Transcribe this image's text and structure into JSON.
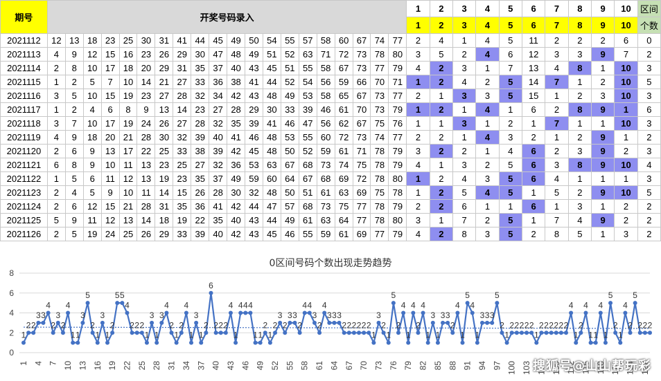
{
  "sheet": {
    "issue_header": "期号",
    "numbers_header": "开奖号码录入",
    "zone_header_top": [
      "1",
      "2",
      "3",
      "4",
      "5",
      "6",
      "7",
      "8",
      "9",
      "10"
    ],
    "zone_header_bottom": [
      "1",
      "2",
      "3",
      "4",
      "5",
      "6",
      "7",
      "8",
      "9",
      "10"
    ],
    "count_header_top": "区间",
    "count_header_bottom": "个数",
    "rows": [
      {
        "issue": "2021112",
        "nums": [
          "12",
          "13",
          "18",
          "23",
          "25",
          "30",
          "31",
          "41",
          "44",
          "45",
          "49",
          "50",
          "54",
          "55",
          "57",
          "58",
          "60",
          "67",
          "74",
          "77"
        ],
        "zones": [
          "2",
          "4",
          "1",
          "4",
          "5",
          "11",
          "2",
          "2",
          "2",
          "6"
        ],
        "count": "0",
        "hits": []
      },
      {
        "issue": "2021113",
        "nums": [
          "4",
          "9",
          "12",
          "15",
          "16",
          "23",
          "26",
          "29",
          "30",
          "47",
          "48",
          "49",
          "51",
          "52",
          "63",
          "71",
          "72",
          "73",
          "78",
          "80"
        ],
        "zones": [
          "3",
          "5",
          "2",
          "4",
          "6",
          "12",
          "3",
          "3",
          "9",
          "7"
        ],
        "count": "2",
        "hits": [
          3,
          8
        ]
      },
      {
        "issue": "2021114",
        "nums": [
          "2",
          "8",
          "10",
          "17",
          "18",
          "20",
          "29",
          "31",
          "35",
          "37",
          "40",
          "43",
          "45",
          "51",
          "55",
          "58",
          "67",
          "73",
          "77",
          "79"
        ],
        "zones": [
          "4",
          "2",
          "3",
          "1",
          "7",
          "13",
          "4",
          "8",
          "1",
          "10"
        ],
        "count": "3",
        "hits": [
          1,
          7,
          9
        ]
      },
      {
        "issue": "2021115",
        "nums": [
          "1",
          "2",
          "5",
          "7",
          "10",
          "14",
          "21",
          "27",
          "33",
          "36",
          "38",
          "41",
          "44",
          "52",
          "54",
          "56",
          "59",
          "66",
          "70",
          "71"
        ],
        "zones": [
          "1",
          "2",
          "4",
          "2",
          "5",
          "14",
          "7",
          "1",
          "2",
          "10"
        ],
        "count": "5",
        "hits": [
          0,
          1,
          4,
          6,
          9
        ]
      },
      {
        "issue": "2021116",
        "nums": [
          "3",
          "5",
          "10",
          "15",
          "19",
          "23",
          "27",
          "28",
          "32",
          "34",
          "42",
          "43",
          "48",
          "49",
          "53",
          "58",
          "65",
          "67",
          "73",
          "77"
        ],
        "zones": [
          "2",
          "1",
          "3",
          "3",
          "5",
          "15",
          "1",
          "2",
          "3",
          "10"
        ],
        "count": "3",
        "hits": [
          2,
          4,
          9
        ]
      },
      {
        "issue": "2021117",
        "nums": [
          "1",
          "2",
          "4",
          "6",
          "8",
          "9",
          "13",
          "14",
          "23",
          "27",
          "28",
          "29",
          "30",
          "33",
          "39",
          "46",
          "61",
          "70",
          "73",
          "79"
        ],
        "zones": [
          "1",
          "2",
          "1",
          "4",
          "1",
          "6",
          "2",
          "8",
          "9",
          "1"
        ],
        "count": "6",
        "hits": [
          0,
          1,
          3,
          7,
          8,
          9
        ]
      },
      {
        "issue": "2021118",
        "nums": [
          "3",
          "7",
          "10",
          "17",
          "19",
          "24",
          "26",
          "27",
          "28",
          "32",
          "35",
          "39",
          "41",
          "46",
          "47",
          "56",
          "62",
          "67",
          "75",
          "76"
        ],
        "zones": [
          "1",
          "1",
          "3",
          "1",
          "2",
          "1",
          "7",
          "1",
          "1",
          "10"
        ],
        "count": "3",
        "hits": [
          2,
          6,
          9
        ]
      },
      {
        "issue": "2021119",
        "nums": [
          "4",
          "9",
          "18",
          "20",
          "21",
          "28",
          "30",
          "32",
          "39",
          "40",
          "41",
          "46",
          "48",
          "53",
          "55",
          "60",
          "72",
          "73",
          "74",
          "77"
        ],
        "zones": [
          "2",
          "2",
          "1",
          "4",
          "3",
          "2",
          "1",
          "2",
          "9",
          "1"
        ],
        "count": "2",
        "hits": [
          3,
          8
        ]
      },
      {
        "issue": "2021120",
        "nums": [
          "2",
          "6",
          "9",
          "13",
          "17",
          "22",
          "25",
          "33",
          "38",
          "39",
          "42",
          "45",
          "48",
          "50",
          "52",
          "59",
          "61",
          "71",
          "78",
          "79"
        ],
        "zones": [
          "3",
          "2",
          "2",
          "1",
          "4",
          "6",
          "2",
          "3",
          "9",
          "2"
        ],
        "count": "3",
        "hits": [
          1,
          5,
          8
        ]
      },
      {
        "issue": "2021121",
        "nums": [
          "6",
          "8",
          "9",
          "10",
          "11",
          "13",
          "23",
          "25",
          "27",
          "32",
          "36",
          "53",
          "63",
          "67",
          "68",
          "73",
          "74",
          "75",
          "78",
          "79"
        ],
        "zones": [
          "4",
          "1",
          "3",
          "2",
          "5",
          "6",
          "3",
          "8",
          "9",
          "10"
        ],
        "count": "4",
        "hits": [
          5,
          7,
          8,
          9
        ]
      },
      {
        "issue": "2021122",
        "nums": [
          "1",
          "5",
          "6",
          "11",
          "12",
          "13",
          "19",
          "23",
          "35",
          "37",
          "49",
          "59",
          "60",
          "64",
          "67",
          "68",
          "69",
          "72",
          "78",
          "80"
        ],
        "zones": [
          "1",
          "2",
          "4",
          "3",
          "5",
          "6",
          "4",
          "1",
          "1",
          "1"
        ],
        "count": "3",
        "hits": [
          0,
          4,
          5
        ]
      },
      {
        "issue": "2021123",
        "nums": [
          "2",
          "4",
          "5",
          "9",
          "10",
          "11",
          "14",
          "15",
          "26",
          "28",
          "30",
          "32",
          "48",
          "50",
          "51",
          "61",
          "63",
          "69",
          "75",
          "78"
        ],
        "zones": [
          "1",
          "2",
          "5",
          "4",
          "5",
          "1",
          "5",
          "2",
          "9",
          "10"
        ],
        "count": "5",
        "hits": [
          1,
          3,
          4,
          8,
          9
        ]
      },
      {
        "issue": "2021124",
        "nums": [
          "2",
          "6",
          "12",
          "15",
          "21",
          "28",
          "31",
          "35",
          "36",
          "41",
          "42",
          "44",
          "47",
          "57",
          "68",
          "73",
          "75",
          "77",
          "78",
          "79"
        ],
        "zones": [
          "2",
          "2",
          "6",
          "1",
          "1",
          "6",
          "1",
          "3",
          "1",
          "2"
        ],
        "count": "2",
        "hits": [
          1,
          5
        ]
      },
      {
        "issue": "2021125",
        "nums": [
          "5",
          "9",
          "11",
          "12",
          "13",
          "14",
          "18",
          "19",
          "22",
          "35",
          "40",
          "43",
          "44",
          "49",
          "61",
          "63",
          "64",
          "77",
          "78",
          "80"
        ],
        "zones": [
          "3",
          "1",
          "7",
          "2",
          "5",
          "1",
          "7",
          "4",
          "9",
          "2"
        ],
        "count": "2",
        "hits": [
          4,
          8
        ]
      },
      {
        "issue": "2021126",
        "nums": [
          "2",
          "5",
          "19",
          "24",
          "25",
          "26",
          "29",
          "33",
          "39",
          "40",
          "42",
          "43",
          "45",
          "46",
          "55",
          "59",
          "61",
          "69",
          "77",
          "79"
        ],
        "zones": [
          "4",
          "2",
          "8",
          "3",
          "5",
          "2",
          "8",
          "5",
          "1",
          "3"
        ],
        "count": "2",
        "hits": [
          1,
          4
        ]
      }
    ]
  },
  "chart_data": {
    "type": "line",
    "title": "0区间号码个数出现走势趋势",
    "ylim": [
      0,
      8
    ],
    "yticks": [
      0,
      2,
      4,
      6,
      8
    ],
    "x_tick_labels": [
      "1",
      "4",
      "7",
      "10",
      "13",
      "16",
      "19",
      "22",
      "25",
      "28",
      "31",
      "34",
      "37",
      "40",
      "43",
      "46",
      "49",
      "52",
      "55",
      "58",
      "61",
      "64",
      "67",
      "70",
      "73",
      "76",
      "79",
      "82",
      "85",
      "88",
      "91",
      "94",
      "97",
      "100",
      "103",
      "106",
      "109",
      "112",
      "115",
      "118",
      "121",
      "124",
      "127"
    ],
    "trendline": true,
    "grid": "horizontal",
    "series": [
      {
        "color": "#4472c4",
        "values": [
          1,
          2,
          2,
          3,
          3,
          4,
          2,
          3,
          2,
          4,
          1,
          1,
          3,
          5,
          2,
          1,
          3,
          1,
          2,
          5,
          5,
          4,
          2,
          2,
          2,
          1,
          3,
          1,
          3,
          4,
          2,
          1,
          2,
          4,
          1,
          3,
          1,
          2,
          6,
          2,
          2,
          2,
          4,
          1,
          4,
          4,
          4,
          1,
          1,
          2,
          1,
          2,
          3,
          2,
          3,
          3,
          2,
          4,
          4,
          3,
          2,
          4,
          3,
          3,
          3,
          2,
          2,
          2,
          2,
          2,
          2,
          1,
          3,
          2,
          1,
          5,
          2,
          4,
          1,
          4,
          2,
          4,
          1,
          3,
          1,
          3,
          3,
          2,
          4,
          1,
          5,
          4,
          1,
          3,
          3,
          3,
          5,
          2,
          1,
          2,
          2,
          2,
          2,
          2,
          1,
          2,
          2,
          2,
          2,
          2,
          2,
          4,
          1,
          2,
          4,
          1,
          1,
          4,
          1,
          5,
          2,
          1,
          4,
          2,
          5,
          2,
          2,
          2
        ]
      }
    ]
  },
  "watermark": "搜狐号@山山帮玩彩"
}
